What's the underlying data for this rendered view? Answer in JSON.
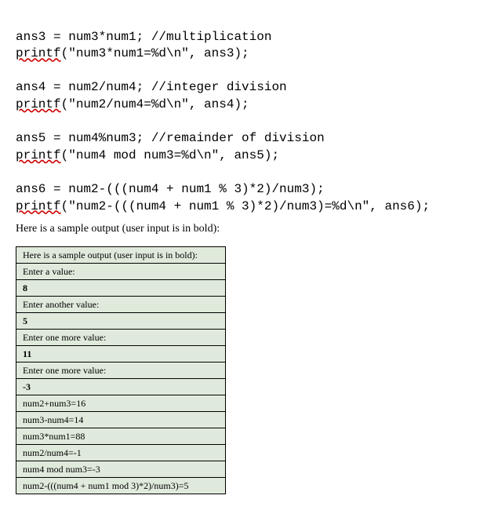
{
  "code": {
    "l1a": "ans3 = num3*num1; ",
    "l1c": "//multiplication",
    "l2a": "printf",
    "l2b": "(\"num3*num1=%d\\n\", ans3);",
    "l3": "",
    "l4a": "ans4 = num2/num4; ",
    "l4c": "//integer division",
    "l5a": "printf",
    "l5b": "(\"num2/num4=%d\\n\", ans4);",
    "l6": "",
    "l7a": "ans5 = num4%num3; ",
    "l7c": "//remainder of division",
    "l8a": "printf",
    "l8b": "(\"num4 mod num3=%d\\n\", ans5);",
    "l9": "",
    "l10a": "ans6 = num2-(((num4 + num1 % 3)*2)/num3);",
    "l11a": "printf",
    "l11b": "(\"num2-(((num4 + num1 % 3)*2)/num3)=%d\\n\", ans6);"
  },
  "paragraph": "Here is a sample output (user input is in bold):",
  "output": {
    "header": "Here is a sample output (user input is in bold):",
    "r1": "Enter a value:",
    "r2": "8",
    "r3": "Enter another value:",
    "r4": "5",
    "r5": "Enter one more value:",
    "r6": "11",
    "r7": "Enter one more value:",
    "r8": "-3",
    "r9": "num2+num3=16",
    "r10": "num3-num4=14",
    "r11": "num3*num1=88",
    "r12": "num2/num4=-1",
    "r13": "num4 mod num3=-3",
    "r14": "num2-(((num4 + num1 mod 3)*2)/num3)=5"
  }
}
